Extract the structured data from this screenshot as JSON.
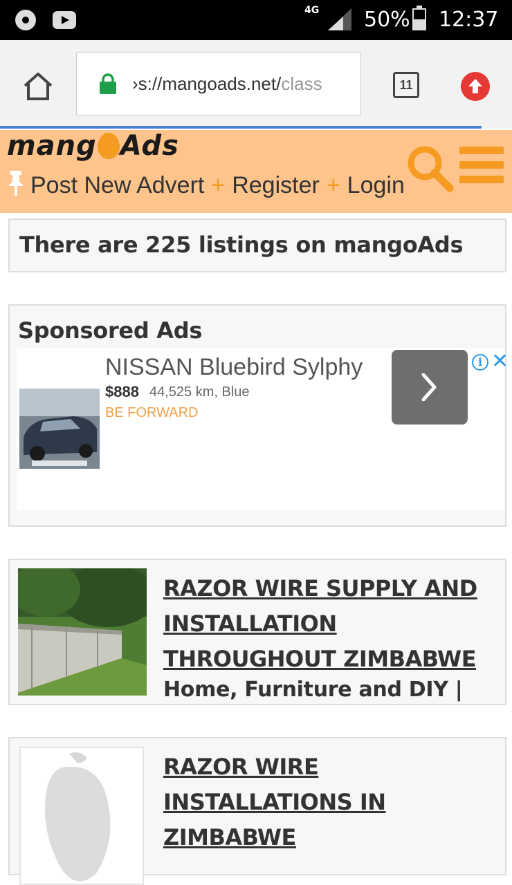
{
  "status_bar": {
    "network": "4G",
    "battery_text": "50%",
    "battery_level": 0.5,
    "time": "12:37",
    "icons": [
      "chrome-icon",
      "youtube-icon",
      "signal-icon",
      "battery-icon"
    ]
  },
  "browser": {
    "url_visible": "›s://mangoads.net/",
    "url_faded": "class",
    "tab_count": "11",
    "icons": [
      "home-icon",
      "lock-icon",
      "tabs-icon",
      "update-icon"
    ]
  },
  "site_header": {
    "logo_left": "mang",
    "logo_right": "Ads",
    "nav": {
      "post": "Post New Advert",
      "sep1": "+",
      "register": "Register",
      "sep2": "+",
      "login": "Login"
    },
    "icons": [
      "pin-icon",
      "search-icon",
      "menu-icon"
    ],
    "accent": "#f59b22",
    "background": "#ffc48c"
  },
  "listings_count_text": "There are 225 listings on mangoAds",
  "sponsored": {
    "heading": "Sponsored Ads",
    "ad": {
      "title": "NISSAN Bluebird Sylphy",
      "price": "$888",
      "meta": "44,525 km, Blue",
      "advertiser": "BE FORWARD",
      "info_glyph": "i",
      "close_glyph": "✕",
      "icons": [
        "info-icon",
        "close-icon",
        "chevron-right-icon"
      ]
    }
  },
  "listings": [
    {
      "title": "RAZOR WIRE SUPPLY AND INSTALLATION THROUGHOUT ZIMBABWE",
      "category": "Home, Furniture and DIY |"
    },
    {
      "title": "RAZOR WIRE INSTALLATIONS IN ZIMBABWE",
      "category": ""
    }
  ]
}
